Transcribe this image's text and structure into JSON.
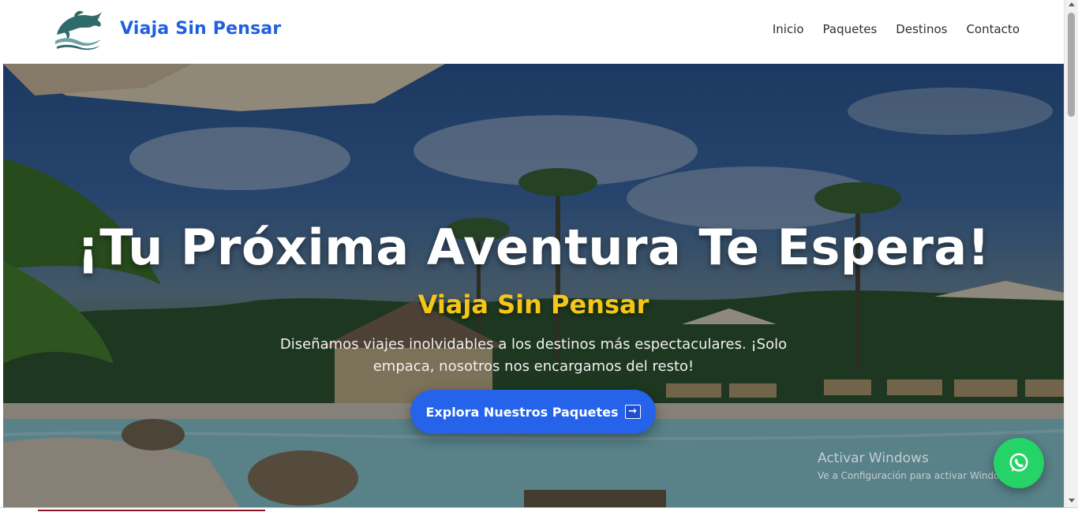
{
  "navbar": {
    "brand": "Viaja Sin Pensar",
    "logo_icon": "dolphin-wave-logo",
    "links": [
      {
        "label": "Inicio"
      },
      {
        "label": "Paquetes"
      },
      {
        "label": "Destinos"
      },
      {
        "label": "Contacto"
      }
    ]
  },
  "hero": {
    "title": "¡Tu Próxima Aventura Te Espera!",
    "subtitle": "Viaja Sin Pensar",
    "description": "Diseñamos viajes inolvidables a los destinos más espectaculares. ¡Solo empaca, nosotros nos encargamos del resto!",
    "cta_label": "Explora Nuestros Paquetes",
    "cta_icon": "arrow-right-icon",
    "background": "tropical-resort-pool-palm-trees"
  },
  "watermark": {
    "title": "Activar Windows",
    "subtitle": "Ve a Configuración para activar Windows."
  },
  "floating": {
    "whatsapp_icon": "whatsapp-icon"
  },
  "colors": {
    "brand": "#1f5fe0",
    "accent_yellow": "#f5c518",
    "cta": "#2563eb",
    "whatsapp": "#25d366"
  }
}
